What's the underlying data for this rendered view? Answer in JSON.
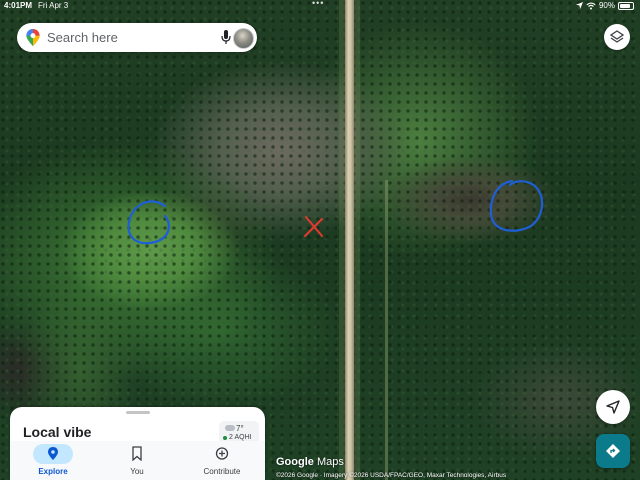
{
  "status_bar": {
    "time": "4:01PM",
    "date": "Fri Apr 3",
    "dots": "•••",
    "battery": "90%",
    "icons": [
      "location-arrow-icon",
      "wifi-icon",
      "battery-icon"
    ]
  },
  "search": {
    "placeholder": "Search here",
    "icons": [
      "maps-pin-icon",
      "mic-icon",
      "avatar"
    ]
  },
  "map": {
    "type": "satellite",
    "annotations": [
      "blue circle",
      "red x",
      "blue circle"
    ]
  },
  "bottom_sheet": {
    "title": "Local vibe",
    "weather": {
      "temp": "7°",
      "aqi": "2 AQHI"
    }
  },
  "nav": {
    "explore": "Explore",
    "you": "You",
    "contribute": "Contribute"
  },
  "logo": {
    "google": "Google",
    "maps": "Maps"
  },
  "attribution": "©2026 Google · Imagery ©2026 USDA/FPAC/GEO, Maxar Technologies, Airbus",
  "colors": {
    "accent": "#1a73e8",
    "directions": "#0b7b8b",
    "nav_active": "#c2e7ff",
    "annotation_blue": "#1e5fd6",
    "annotation_red": "#e23b2e"
  }
}
